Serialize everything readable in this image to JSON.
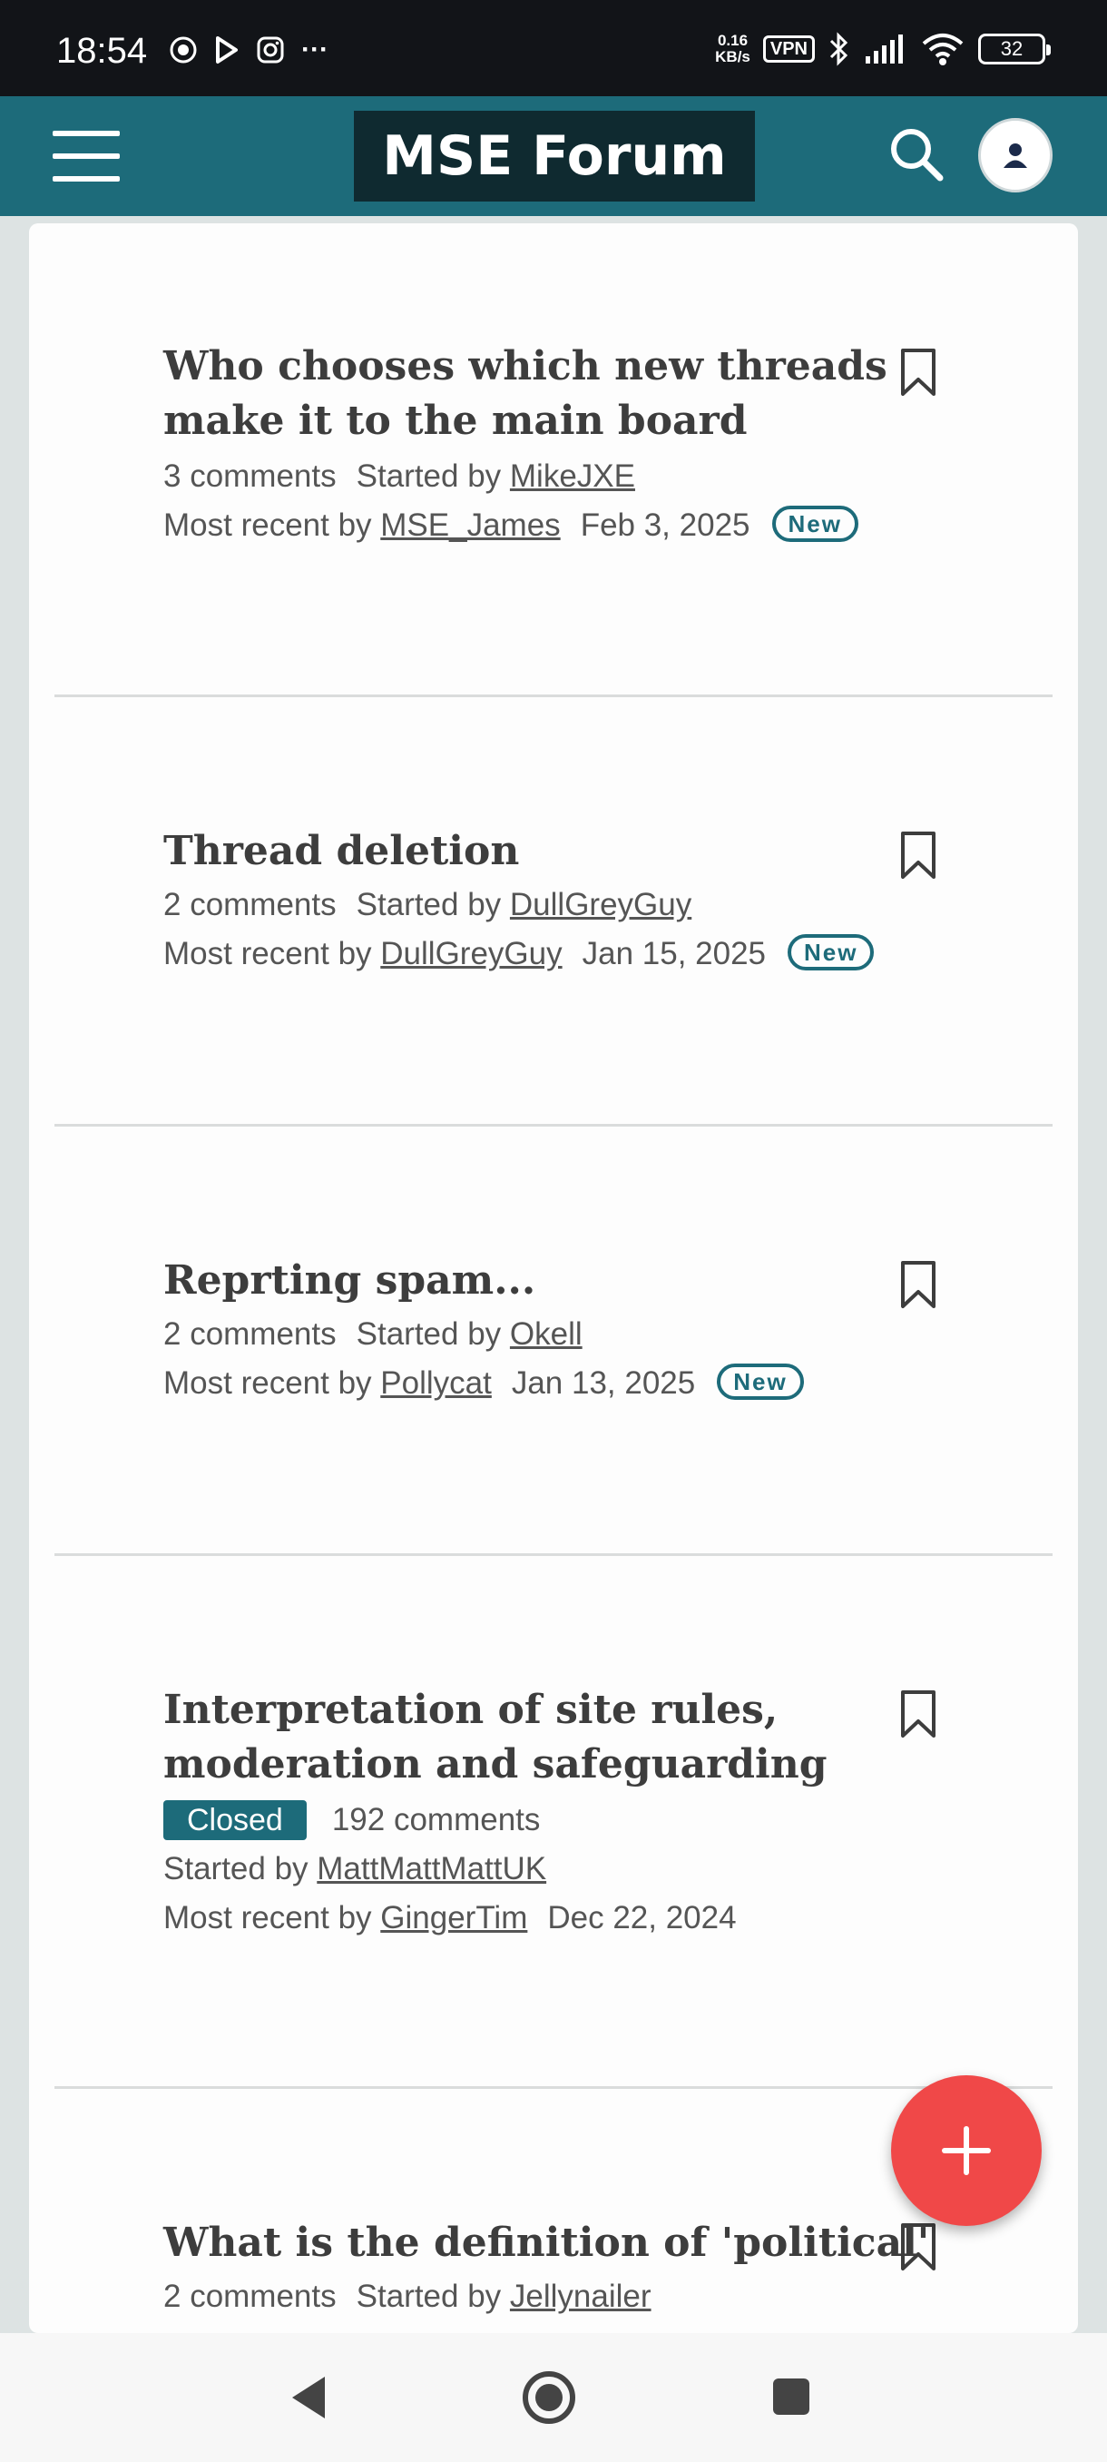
{
  "status_bar": {
    "time": "18:54",
    "net_speed_value": "0.16",
    "net_speed_unit": "KB/s",
    "vpn": "VPN",
    "battery": "32",
    "more": "···"
  },
  "header": {
    "title": "MSE Forum",
    "menu_icon": "hamburger-icon",
    "search_icon": "search-icon",
    "avatar_icon": "user-icon",
    "accent_color": "#1d6b7a",
    "logo_bg": "#0f2a30"
  },
  "threads": [
    {
      "title_line1": "Who chooses which new threads",
      "title_line2": "make it to the main board",
      "comments": "3 comments",
      "started_label": "Started by",
      "started_by": "MikeJXE",
      "recent_label": "Most recent by",
      "recent_by": "MSE_James",
      "date": "Feb 3, 2025",
      "badge": "New"
    },
    {
      "title_line1": "Thread deletion",
      "comments": "2 comments",
      "started_label": "Started by",
      "started_by": "DullGreyGuy",
      "recent_label": "Most recent by",
      "recent_by": "DullGreyGuy",
      "date": "Jan 15, 2025",
      "badge": "New"
    },
    {
      "title_line1": "Reprting spam...",
      "comments": "2 comments",
      "started_label": "Started by",
      "started_by": "Okell",
      "recent_label": "Most recent by",
      "recent_by": "Pollycat",
      "date": "Jan 13, 2025",
      "badge": "New"
    },
    {
      "title_line1": "Interpretation of site rules,",
      "title_line2": "moderation and safeguarding",
      "status": "Closed",
      "comments": "192 comments",
      "started_label": "Started by",
      "started_by": "MattMattMattUK",
      "recent_label": "Most recent by",
      "recent_by": "GingerTim",
      "date": "Dec 22, 2024"
    },
    {
      "title_line1": "What is the definition of 'political'",
      "comments": "2 comments",
      "started_label": "Started by",
      "started_by": "Jellynailer"
    }
  ],
  "fab": {
    "icon": "plus-icon",
    "color": "#f04848"
  },
  "nav": {
    "back_icon": "back-triangle-icon",
    "home_icon": "home-circle-icon",
    "recents_icon": "recents-square-icon"
  }
}
